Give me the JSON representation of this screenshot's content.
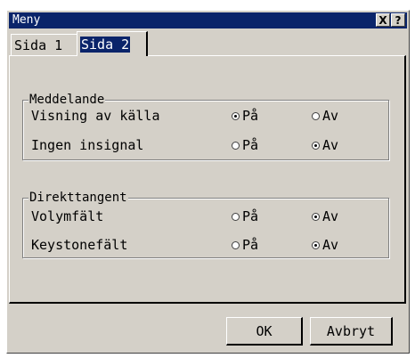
{
  "window": {
    "title": "Meny",
    "help_label": "?",
    "close_label": "X"
  },
  "tabs": [
    {
      "label": "Sida 1",
      "selected": false
    },
    {
      "label": "Sida 2",
      "selected": true
    }
  ],
  "groups": [
    {
      "title": "Meddelande",
      "rows": [
        {
          "label": "Visning av källa",
          "options": [
            "På",
            "Av"
          ],
          "selected": "På"
        },
        {
          "label": "Ingen insignal",
          "options": [
            "På",
            "Av"
          ],
          "selected": "Av"
        }
      ]
    },
    {
      "title": "Direkttangent",
      "rows": [
        {
          "label": "Volymfält",
          "options": [
            "På",
            "Av"
          ],
          "selected": "Av"
        },
        {
          "label": "Keystonefält",
          "options": [
            "På",
            "Av"
          ],
          "selected": "Av"
        }
      ]
    }
  ],
  "buttons": {
    "ok": "OK",
    "cancel": "Avbryt"
  },
  "colors": {
    "title_bar": "#0a246a",
    "face": "#d4d0c8"
  }
}
